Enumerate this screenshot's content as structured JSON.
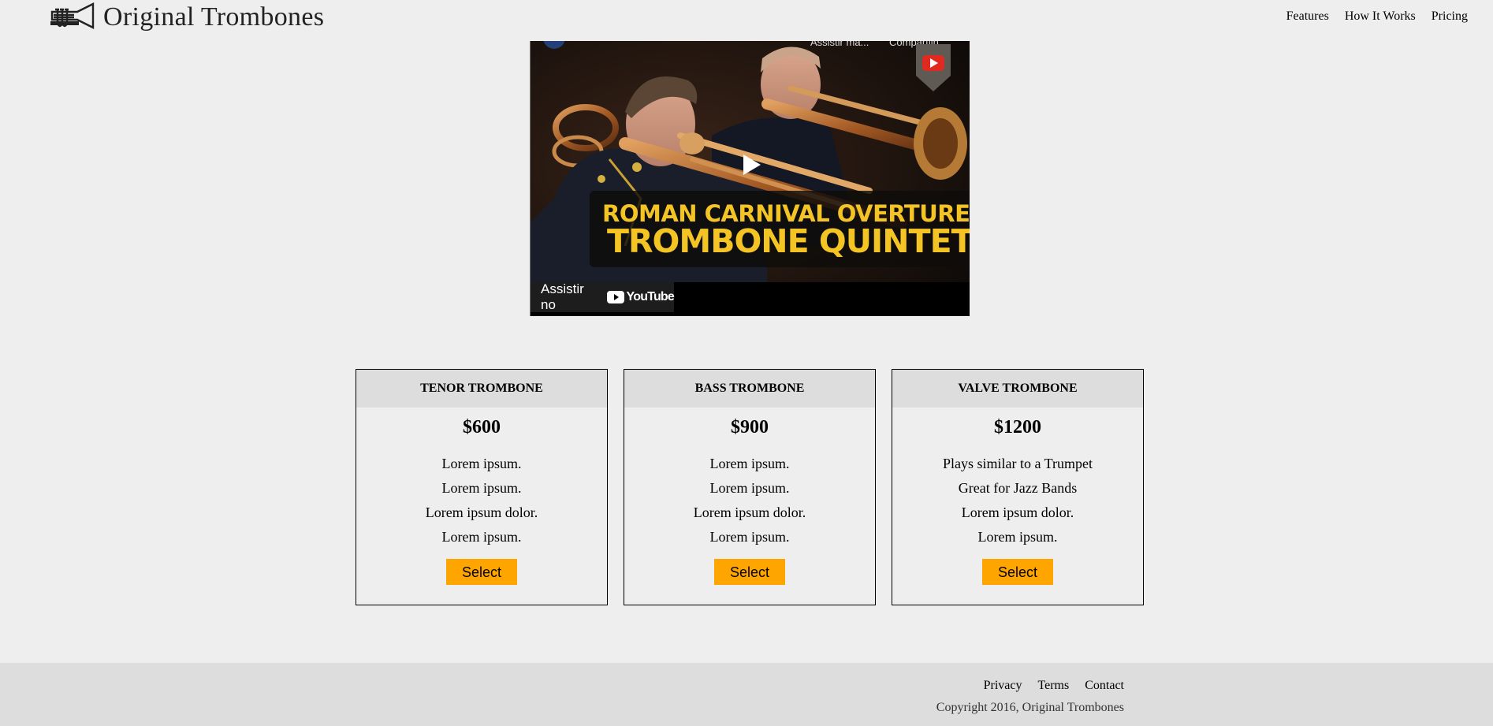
{
  "header": {
    "logo_text": "Original Trombones",
    "nav": [
      "Features",
      "How It Works",
      "Pricing"
    ]
  },
  "video": {
    "top_watch_label": "Assistir ma...",
    "top_share_label": "Compartilh...",
    "title_line1": "ROMAN CARNIVAL OVERTURE",
    "title_line2": "TROMBONE QUINTET",
    "watch_on_label": "Assistir no",
    "youtube_wordmark": "YouTube",
    "colors": {
      "title": "#f3c424",
      "youtube_red": "#e02a20"
    }
  },
  "pricing": [
    {
      "name": "TENOR TROMBONE",
      "price": "$600",
      "features": [
        "Lorem ipsum.",
        "Lorem ipsum.",
        "Lorem ipsum dolor.",
        "Lorem ipsum."
      ],
      "button": "Select"
    },
    {
      "name": "BASS TROMBONE",
      "price": "$900",
      "features": [
        "Lorem ipsum.",
        "Lorem ipsum.",
        "Lorem ipsum dolor.",
        "Lorem ipsum."
      ],
      "button": "Select"
    },
    {
      "name": "VALVE TROMBONE",
      "price": "$1200",
      "features": [
        "Plays similar to a Trumpet",
        "Great for Jazz Bands",
        "Lorem ipsum dolor.",
        "Lorem ipsum."
      ],
      "button": "Select"
    }
  ],
  "footer": {
    "links": [
      "Privacy",
      "Terms",
      "Contact"
    ],
    "copyright": "Copyright 2016, Original Trombones"
  },
  "colors": {
    "background": "#eeeeee",
    "card_header": "#dddddd",
    "button": "#ffa500",
    "footer": "#dddddd"
  }
}
